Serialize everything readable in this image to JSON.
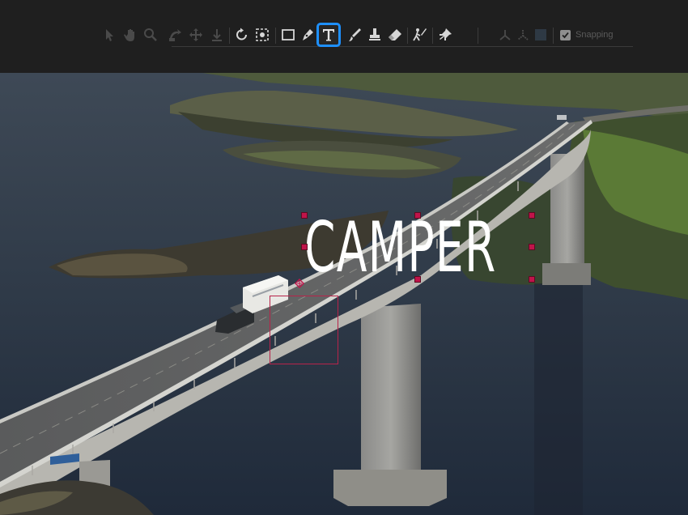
{
  "toolbar": {
    "tools": [
      {
        "name": "select-tool-icon",
        "state": "disabled"
      },
      {
        "name": "hand-tool-icon",
        "state": "disabled"
      },
      {
        "name": "zoom-tool-icon",
        "state": "disabled"
      },
      {
        "name": "orbit-tool-icon",
        "state": "disabled"
      },
      {
        "name": "move-tool-icon",
        "state": "disabled"
      },
      {
        "name": "anchor-tool-icon",
        "state": "disabled"
      },
      {
        "name": "rotate-tool-icon",
        "state": "enabled"
      },
      {
        "name": "camera-tool-icon",
        "state": "enabled"
      },
      {
        "name": "rectangle-tool-icon",
        "state": "enabled"
      },
      {
        "name": "pen-tool-icon",
        "state": "enabled"
      },
      {
        "name": "type-tool-icon",
        "state": "active"
      },
      {
        "name": "brush-tool-icon",
        "state": "enabled"
      },
      {
        "name": "clone-stamp-tool-icon",
        "state": "enabled"
      },
      {
        "name": "eraser-tool-icon",
        "state": "enabled"
      },
      {
        "name": "roto-brush-tool-icon",
        "state": "enabled"
      },
      {
        "name": "puppet-pin-tool-icon",
        "state": "enabled"
      },
      {
        "name": "axis-mode-icon",
        "state": "disabled"
      }
    ],
    "snapping_checked": true,
    "snapping_label": "Snapping",
    "active_color": "#1e90ff"
  },
  "canvas": {
    "text_layer": {
      "text": "CAMPER",
      "color": "#ffffff",
      "handle_color": "#c0144a"
    }
  }
}
